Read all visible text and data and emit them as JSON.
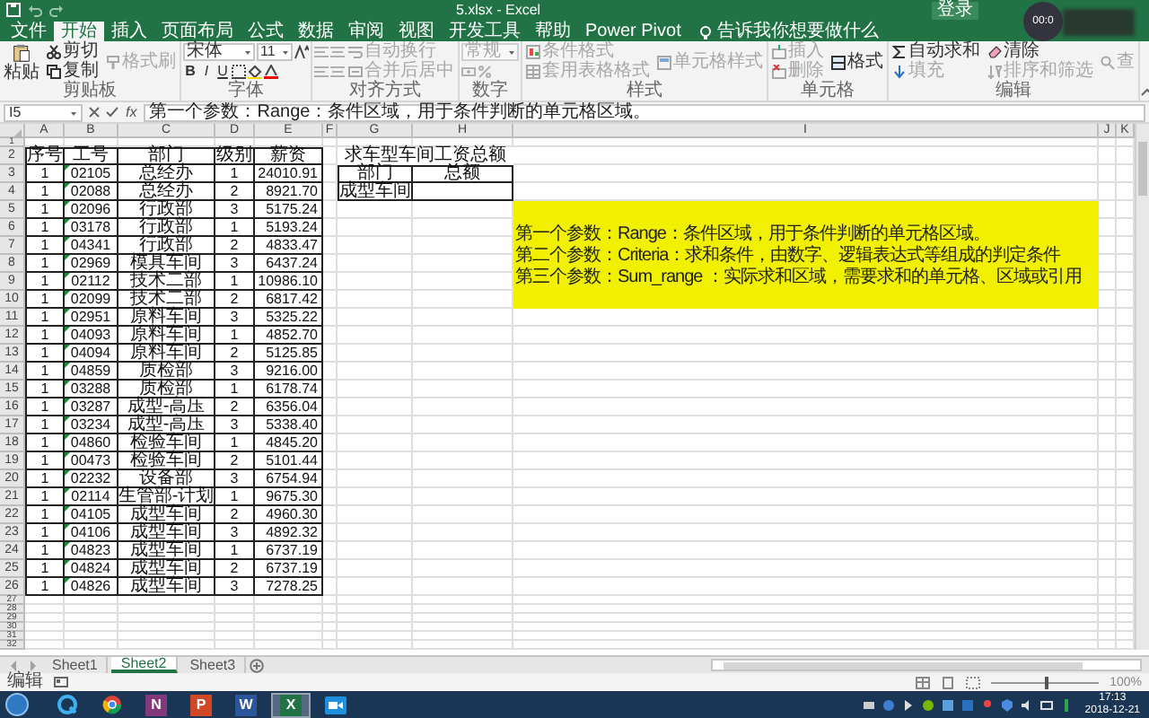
{
  "window": {
    "title": "5.xlsx - Excel",
    "sign_in": "登录"
  },
  "recorder": {
    "time": "00:0"
  },
  "tabs": [
    {
      "label": "文件",
      "selected": false
    },
    {
      "label": "开始",
      "selected": true
    },
    {
      "label": "插入",
      "selected": false
    },
    {
      "label": "页面布局",
      "selected": false
    },
    {
      "label": "公式",
      "selected": false
    },
    {
      "label": "数据",
      "selected": false
    },
    {
      "label": "审阅",
      "selected": false
    },
    {
      "label": "视图",
      "selected": false
    },
    {
      "label": "开发工具",
      "selected": false
    },
    {
      "label": "帮助",
      "selected": false
    },
    {
      "label": "Power Pivot",
      "selected": false
    }
  ],
  "tell_me": "告诉我你想要做什么",
  "ribbon": {
    "groups": [
      {
        "kind": "clipboard",
        "label": "剪贴板",
        "items": [
          {
            "label": "粘贴",
            "disabled": false
          },
          {
            "label": "剪切",
            "disabled": false
          },
          {
            "label": "复制",
            "disabled": false
          },
          {
            "label": "格式刷",
            "disabled": true
          }
        ]
      },
      {
        "kind": "font",
        "label": "字体",
        "font": "宋体",
        "size": "11",
        "styles": [
          "B",
          "I",
          "U"
        ]
      },
      {
        "kind": "alignment",
        "label": "对齐方式",
        "items": [
          {
            "label": "自动换行",
            "disabled": true
          },
          {
            "label": "合并后居中",
            "disabled": true
          }
        ]
      },
      {
        "kind": "number",
        "label": "数字",
        "format": "常规"
      },
      {
        "kind": "styles",
        "label": "样式",
        "items": [
          {
            "label": "条件格式",
            "disabled": true
          },
          {
            "label": "套用表格格式",
            "disabled": true
          },
          {
            "label": "单元格样式",
            "disabled": true
          }
        ]
      },
      {
        "kind": "cells",
        "label": "单元格",
        "items": [
          {
            "label": "插入",
            "disabled": true
          },
          {
            "label": "删除",
            "disabled": true
          },
          {
            "label": "格式",
            "disabled": false
          }
        ]
      },
      {
        "kind": "editing",
        "label": "编辑",
        "items": [
          {
            "label": "自动求和",
            "disabled": false
          },
          {
            "label": "填充",
            "disabled": true
          },
          {
            "label": "清除",
            "disabled": false
          },
          {
            "label": "排序和筛选",
            "disabled": true
          },
          {
            "label": "查",
            "disabled": true
          }
        ]
      }
    ]
  },
  "formula_bar": {
    "name_box": "I5",
    "fx": "fx",
    "formula": "第一个参数：Range：条件区域，用于条件判断的单元格区域。"
  },
  "sheet": {
    "columns": [
      "A",
      "B",
      "C",
      "D",
      "E",
      "F",
      "G",
      "H",
      "I",
      "J",
      "K"
    ],
    "row_numbers": [
      "1",
      "2",
      "3",
      "4",
      "5",
      "6",
      "7",
      "8",
      "9",
      "10",
      "11",
      "12",
      "13",
      "14",
      "15",
      "16",
      "17",
      "18",
      "19",
      "20",
      "21",
      "22",
      "23",
      "24",
      "25",
      "26",
      "27",
      "28",
      "29",
      "30",
      "31",
      "32"
    ],
    "table": {
      "header": [
        "序号",
        "工号",
        "部门",
        "级别",
        "薪资"
      ],
      "rows": [
        [
          "1",
          "02105",
          "总经办",
          "1",
          "24010.91"
        ],
        [
          "1",
          "02088",
          "总经办",
          "2",
          "8921.70"
        ],
        [
          "1",
          "02096",
          "行政部",
          "3",
          "5175.24"
        ],
        [
          "1",
          "03178",
          "行政部",
          "1",
          "5193.24"
        ],
        [
          "1",
          "04341",
          "行政部",
          "2",
          "4833.47"
        ],
        [
          "1",
          "02969",
          "模具车间",
          "3",
          "6437.24"
        ],
        [
          "1",
          "02112",
          "技术二部",
          "1",
          "10986.10"
        ],
        [
          "1",
          "02099",
          "技术二部",
          "2",
          "6817.42"
        ],
        [
          "1",
          "02951",
          "原料车间",
          "3",
          "5325.22"
        ],
        [
          "1",
          "04093",
          "原料车间",
          "1",
          "4852.70"
        ],
        [
          "1",
          "04094",
          "原料车间",
          "2",
          "5125.85"
        ],
        [
          "1",
          "04859",
          "质检部",
          "3",
          "9216.00"
        ],
        [
          "1",
          "03288",
          "质检部",
          "1",
          "6178.74"
        ],
        [
          "1",
          "03287",
          "成型-高压",
          "2",
          "6356.04"
        ],
        [
          "1",
          "03234",
          "成型-高压",
          "3",
          "5338.40"
        ],
        [
          "1",
          "04860",
          "检验车间",
          "1",
          "4845.20"
        ],
        [
          "1",
          "00473",
          "检验车间",
          "2",
          "5101.44"
        ],
        [
          "1",
          "02232",
          "设备部",
          "3",
          "6754.94"
        ],
        [
          "1",
          "02114",
          "生管部-计划",
          "1",
          "9675.30"
        ],
        [
          "1",
          "04105",
          "成型车间",
          "2",
          "4960.30"
        ],
        [
          "1",
          "04106",
          "成型车间",
          "3",
          "4892.32"
        ],
        [
          "1",
          "04823",
          "成型车间",
          "1",
          "6737.19"
        ],
        [
          "1",
          "04824",
          "成型车间",
          "2",
          "6737.19"
        ],
        [
          "1",
          "04826",
          "成型车间",
          "3",
          "7278.25"
        ]
      ]
    },
    "summary": {
      "title": "求车型车间工资总额",
      "headers": [
        "部门",
        "总额"
      ],
      "department": "成型车间"
    },
    "note": {
      "lines": [
        "第一个参数：Range：条件区域，用于条件判断的单元格区域。",
        "第二个参数：Criteria：求和条件，由数字、逻辑表达式等组成的判定条件",
        "第三个参数：Sum_range ：实际求和区域，需要求和的单元格、区域或引用"
      ]
    }
  },
  "sheet_tabs": [
    {
      "label": "Sheet1",
      "selected": false
    },
    {
      "label": "Sheet2",
      "selected": true
    },
    {
      "label": "Sheet3",
      "selected": false
    }
  ],
  "status": {
    "mode": "编辑",
    "zoom": {
      "level": 0.5,
      "label": "100%"
    }
  },
  "taskbar": {
    "apps": [
      {
        "kind": "browser",
        "selected": false
      },
      {
        "kind": "globe",
        "selected": false
      },
      {
        "kind": "letter",
        "letter": "N",
        "color": "#80397b",
        "selected": false
      },
      {
        "kind": "letter",
        "letter": "P",
        "color": "#d24726",
        "selected": false
      },
      {
        "kind": "letter",
        "letter": "W",
        "color": "#2b579a",
        "selected": false
      },
      {
        "kind": "letter",
        "letter": "X",
        "color": "#217346",
        "selected": true
      },
      {
        "kind": "recorder",
        "selected": false
      }
    ],
    "time": "17:13",
    "date": "2018-12-21"
  }
}
